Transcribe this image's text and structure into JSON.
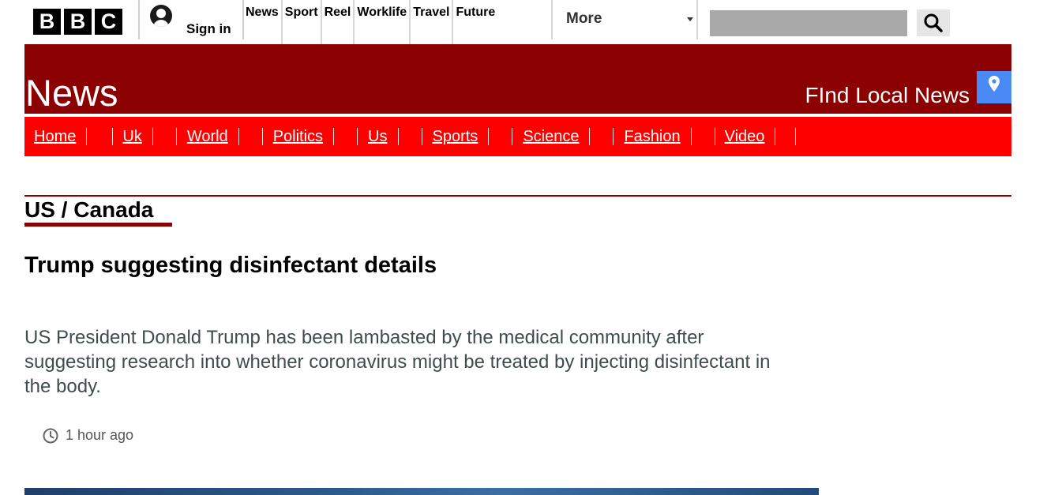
{
  "masthead": {
    "logo_letters": [
      "B",
      "B",
      "C"
    ],
    "signin_label": "Sign in",
    "nav_items": [
      "News",
      "Sport",
      "Reel",
      "Worklife",
      "Travel",
      "Future"
    ],
    "more_label": "More",
    "search_placeholder": ""
  },
  "banner": {
    "brand": "News",
    "find_local": "FInd Local News"
  },
  "section_nav": {
    "items": [
      "Home",
      "Uk",
      "World",
      "Politics",
      "Us",
      "Sports",
      "Science",
      "Fashion",
      "Video"
    ]
  },
  "article": {
    "section": "US / Canada",
    "headline": "Trump suggesting disinfectant details",
    "summary": "US President Donald Trump has been lambasted by the medical community after suggesting research into whether coronavirus might be treated by injecting disinfectant in the body.",
    "timestamp": "1 hour ago"
  },
  "colors": {
    "banner_red": "#8b0000",
    "nav_red": "#ff0000",
    "location_blue": "#4a8af4"
  }
}
